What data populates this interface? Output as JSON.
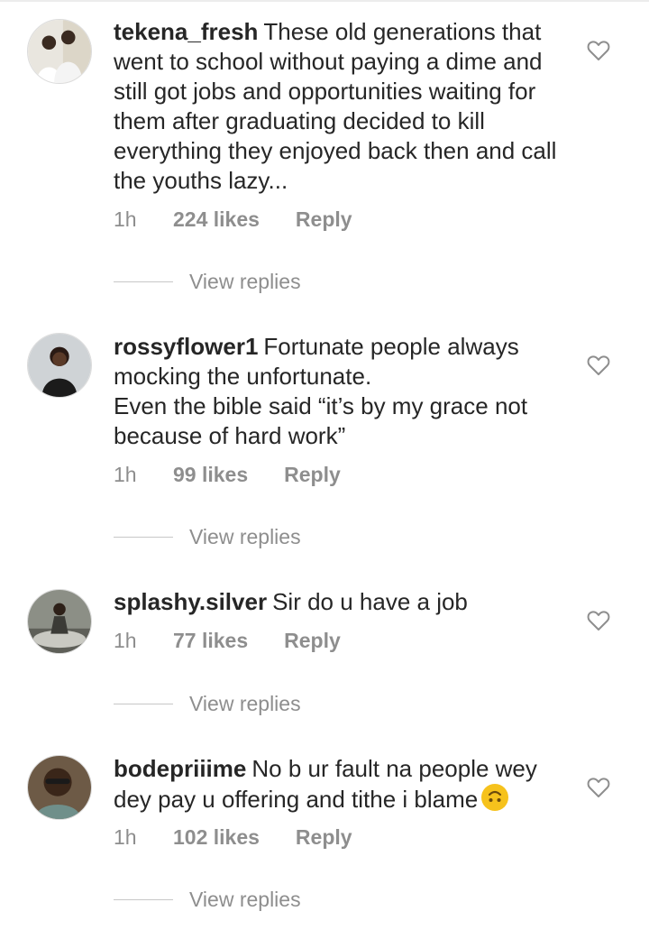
{
  "comments": [
    {
      "username": "tekena_fresh",
      "text": "These old generations that went to school without paying a dime and still got jobs and opportunities waiting for them after graduating decided to kill everything they enjoyed back then and call the youths lazy...",
      "time": "1h",
      "likes": "224 likes",
      "reply_label": "Reply",
      "view_replies_label": "View replies"
    },
    {
      "username": "rossyflower1",
      "text": "Fortunate people always mocking the unfortunate.\nEven the bible said “it’s by my grace not because of hard work”",
      "time": "1h",
      "likes": "99 likes",
      "reply_label": "Reply",
      "view_replies_label": "View replies"
    },
    {
      "username": "splashy.silver",
      "text": "Sir do u have a job",
      "time": "1h",
      "likes": "77 likes",
      "reply_label": "Reply",
      "view_replies_label": "View replies"
    },
    {
      "username": "bodepriiime",
      "text": "No b ur fault na people wey dey pay u offering and tithe i blame",
      "emoji": "upside-down-face-emoji",
      "time": "1h",
      "likes": "102 likes",
      "reply_label": "Reply",
      "view_replies_label": "View replies"
    }
  ],
  "icons": {
    "like": "heart-outline-icon"
  },
  "colors": {
    "text": "#262626",
    "secondary": "#8e8e8e",
    "emoji": "#f6c21c"
  }
}
